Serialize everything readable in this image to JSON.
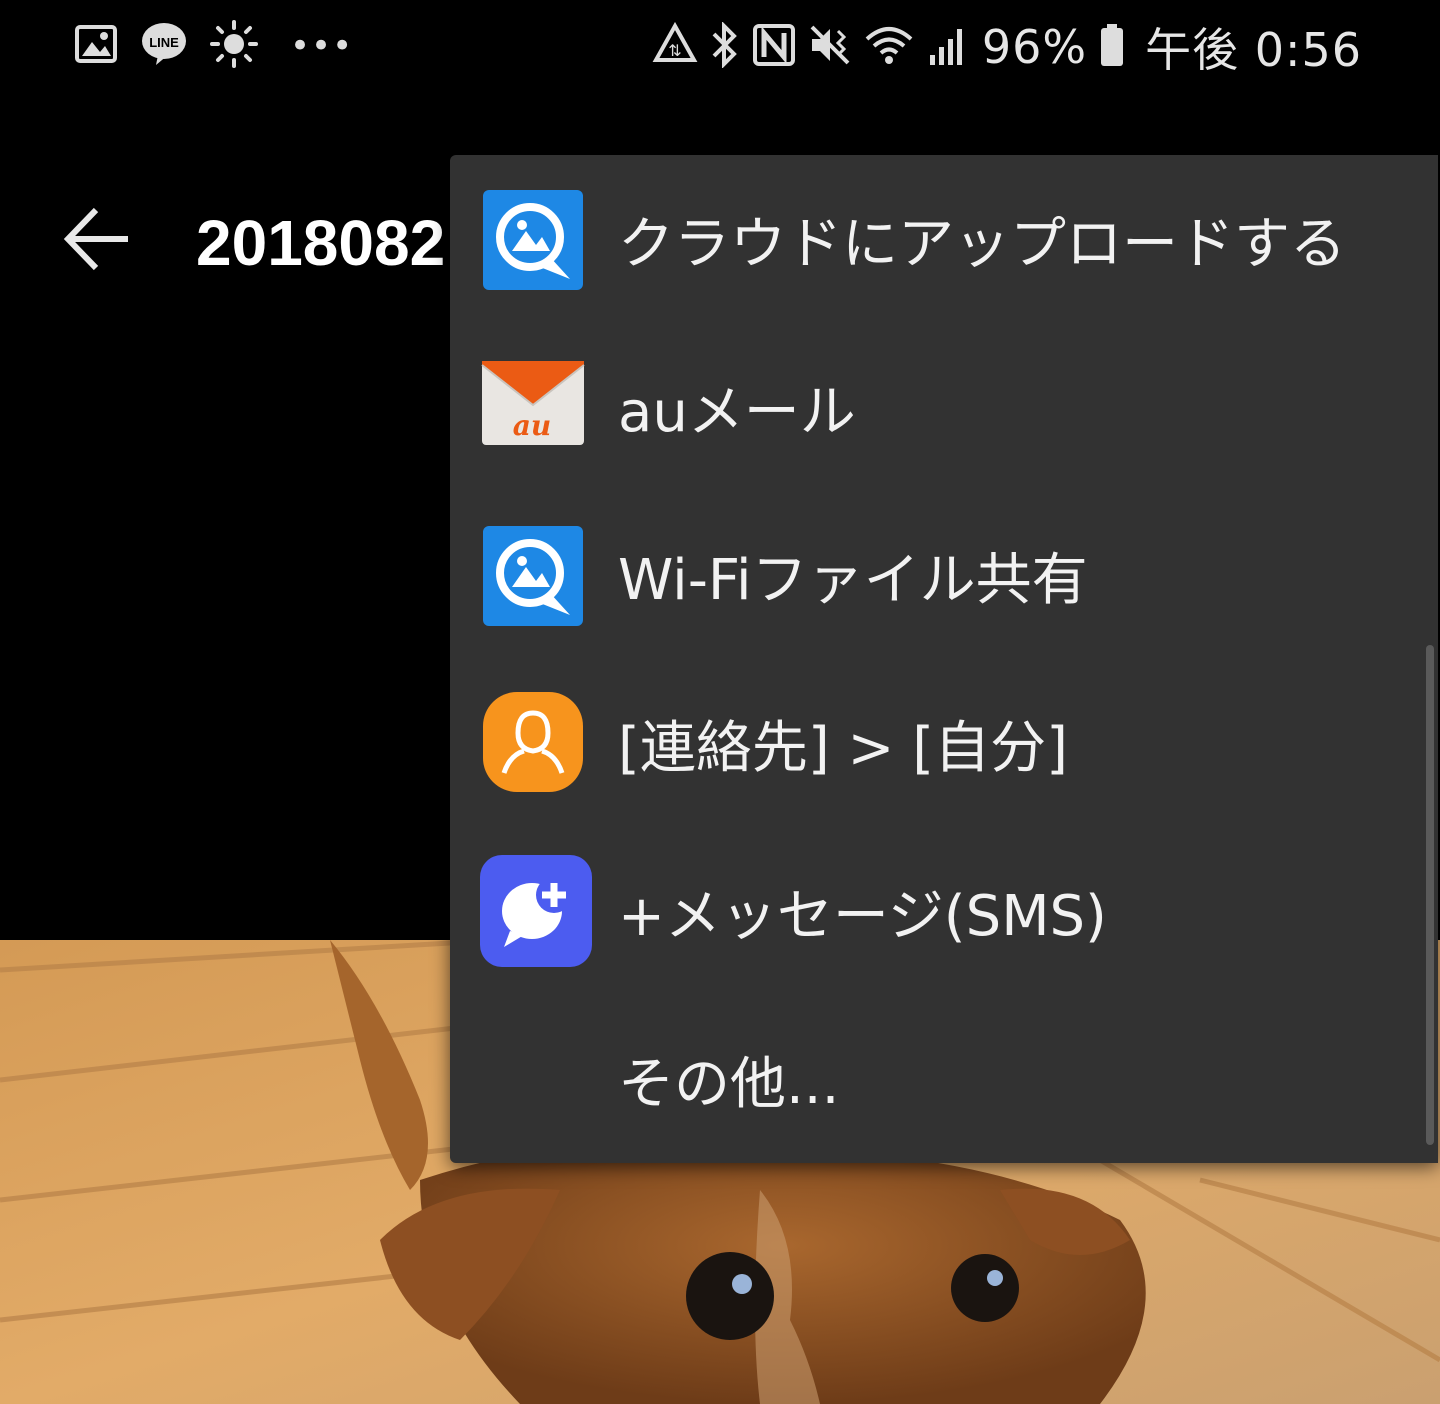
{
  "status_bar": {
    "left_icons": [
      "gallery-icon",
      "line-icon",
      "brightness-icon",
      "more-notifications-icon"
    ],
    "line_badge": "LINE",
    "more": "•••",
    "battery_percent": "96%",
    "time": "午後 0:56"
  },
  "app_bar": {
    "title": "2018082"
  },
  "share_menu": {
    "items": [
      {
        "label": "クラウドにアップロードする",
        "icon": "cloud-photo-app-icon"
      },
      {
        "label": "auメール",
        "icon": "au-mail-icon"
      },
      {
        "label": "Wi-Fiファイル共有",
        "icon": "wifi-share-app-icon"
      },
      {
        "label": "[連絡先] > [自分]",
        "icon": "contacts-icon"
      },
      {
        "label": "+メッセージ(SMS)",
        "icon": "plus-message-icon"
      },
      {
        "label": "その他...",
        "icon": ""
      }
    ],
    "au_icon_text": "au"
  },
  "colors": {
    "menu_bg": "#323232",
    "quickpic_blue": "#1e88e5",
    "au_orange": "#eb5b14",
    "contacts_orange": "#f7941d",
    "message_blue": "#4c5cf0"
  }
}
